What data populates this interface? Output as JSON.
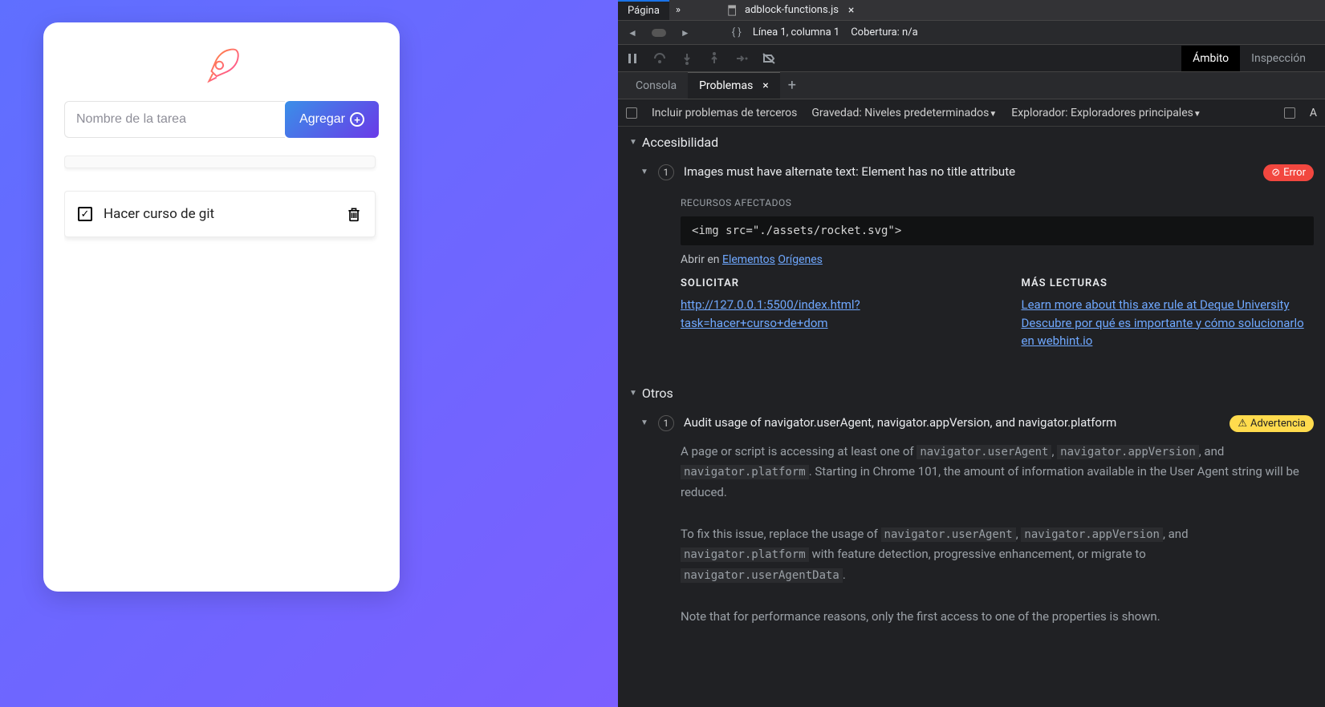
{
  "app": {
    "task_placeholder": "Nombre de la tarea",
    "add_label": "Agregar",
    "tasks": [
      {
        "text": "Hacer curso de git",
        "checked": true
      }
    ]
  },
  "devtools": {
    "top_tab": "Página",
    "file_tab": "adblock-functions.js",
    "cursor_info": "Línea 1, columna 1",
    "coverage": "Cobertura: n/a",
    "scope_tabs": {
      "ambito": "Ámbito",
      "inspeccion": "Inspección"
    },
    "console_tabs": {
      "consola": "Consola",
      "problemas": "Problemas"
    },
    "filters": {
      "third_party": "Incluir problemas de terceros",
      "severity": "Gravedad: Niveles predeterminados",
      "browser": "Explorador: Exploradores principales"
    },
    "sections": {
      "accessibility": {
        "title": "Accesibilidad",
        "issue": {
          "count": "1",
          "title": "Images must have alternate text: Element has no title attribute",
          "badge": "Error",
          "resources_label": "RECURSOS AFECTADOS",
          "code": "<img src=\"./assets/rocket.svg\">",
          "open_in": "Abrir en",
          "link_elements": "Elementos",
          "link_origins": "Orígenes",
          "request_label": "SOLICITAR",
          "request_url": "http://127.0.0.1:5500/index.html?task=hacer+curso+de+dom",
          "more_label": "MÁS LECTURAS",
          "more_link1": "Learn more about this axe rule at Deque University",
          "more_link2": "Descubre por qué es importante y cómo solucionarlo en webhint.io"
        }
      },
      "others": {
        "title": "Otros",
        "issue": {
          "count": "1",
          "title": "Audit usage of navigator.userAgent, navigator.appVersion, and navigator.platform",
          "badge": "Advertencia",
          "desc1_a": "A page or script is accessing at least one of ",
          "desc1_code1": "navigator.userAgent",
          "desc1_b": ", ",
          "desc1_code2": "navigator.appVersion",
          "desc1_c": ", and ",
          "desc1_code3": "navigator.platform",
          "desc1_d": ". Starting in Chrome 101, the amount of information available in the User Agent string will be reduced.",
          "desc2_a": "To fix this issue, replace the usage of ",
          "desc2_code1": "navigator.userAgent",
          "desc2_b": ", ",
          "desc2_code2": "navigator.appVersion",
          "desc2_c": ", and ",
          "desc2_code3": "navigator.platform",
          "desc2_d": " with feature detection, progressive enhancement, or migrate to ",
          "desc2_code4": "navigator.userAgentData",
          "desc2_e": ".",
          "desc3": "Note that for performance reasons, only the first access to one of the properties is shown."
        }
      }
    }
  }
}
